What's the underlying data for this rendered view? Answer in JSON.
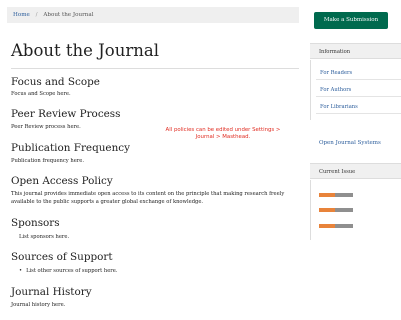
{
  "breadcrumb": {
    "home": "Home",
    "separator": "/",
    "current": "About the Journal"
  },
  "page_title": "About the Journal",
  "sections": [
    {
      "heading": "Focus and Scope",
      "text": "Focus and Scope here."
    },
    {
      "heading": "Peer Review Process",
      "text": "Peer Review process here."
    },
    {
      "heading": "Publication Frequency",
      "text": "Publication frequency here."
    },
    {
      "heading": "Open Access Policy",
      "text": "This journal provides immediate open access to its content on the principle that making research freely available to the public supports a greater global exchange of knowledge."
    },
    {
      "heading": "Sponsors",
      "text": "List sponsors here."
    },
    {
      "heading": "Sources of Support",
      "text": "List other sources of support here."
    },
    {
      "heading": "Journal History",
      "text": "Journal history here."
    }
  ],
  "notice": "All policies can be edited under Settings > Journal > Masthead.",
  "sidebar": {
    "submit_button": "Make a Submission",
    "information": {
      "title": "Information",
      "links": [
        "For Readers",
        "For Authors",
        "For Librarians"
      ]
    },
    "ojs_link": "Open Journal Systems",
    "current_issue": {
      "title": "Current Issue",
      "badges": 3
    }
  },
  "colors": {
    "accent": "#006a4e",
    "link": "#2a5c9b",
    "notice": "#e02b20",
    "badge_orange": "#e8833a",
    "badge_grey": "#8f8f8f"
  }
}
